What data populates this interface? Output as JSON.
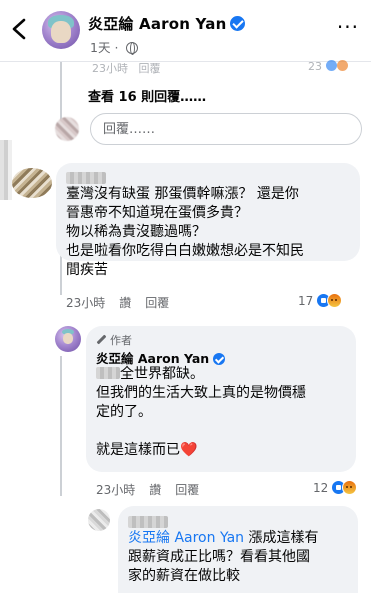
{
  "header": {
    "author": "炎亞綸 Aaron Yan",
    "time": "1天"
  },
  "prev_meta": {
    "time": "23小時",
    "actions": "回覆",
    "count": "23"
  },
  "view_replies": "查看 16 則回覆……",
  "reply_input": {
    "placeholder": "回覆……"
  },
  "comments": [
    {
      "name": "",
      "lines": [
        "臺灣沒有缺蛋 那蛋價幹嘛漲？ 還是你",
        "晉惠帝不知道現在蛋價多貴？",
        "物以稀為貴沒聽過嗎？",
        "也是啦看你吃得白白嫩嫩想必是不知民",
        "間疾苦"
      ],
      "time": "23小時",
      "like": "讚",
      "reply": "回覆",
      "reactions": "17"
    },
    {
      "badge": "作者",
      "name": "炎亞綸 Aaron Yan",
      "line1_suffix": "全世界都缺。",
      "lines": [
        "但我們的生活大致上真的是物價穩",
        "定的了。",
        "",
        "就是這樣而已"
      ],
      "heart": "❤️",
      "time": "23小時",
      "like": "讚",
      "reply": "回覆",
      "reactions": "12"
    },
    {
      "name": "",
      "mention": "炎亞綸 Aaron Yan",
      "line1_suffix": " 漲成這樣有",
      "lines": [
        "跟薪資成正比嗎？看看其他國",
        "家的薪資在做比較"
      ]
    }
  ]
}
